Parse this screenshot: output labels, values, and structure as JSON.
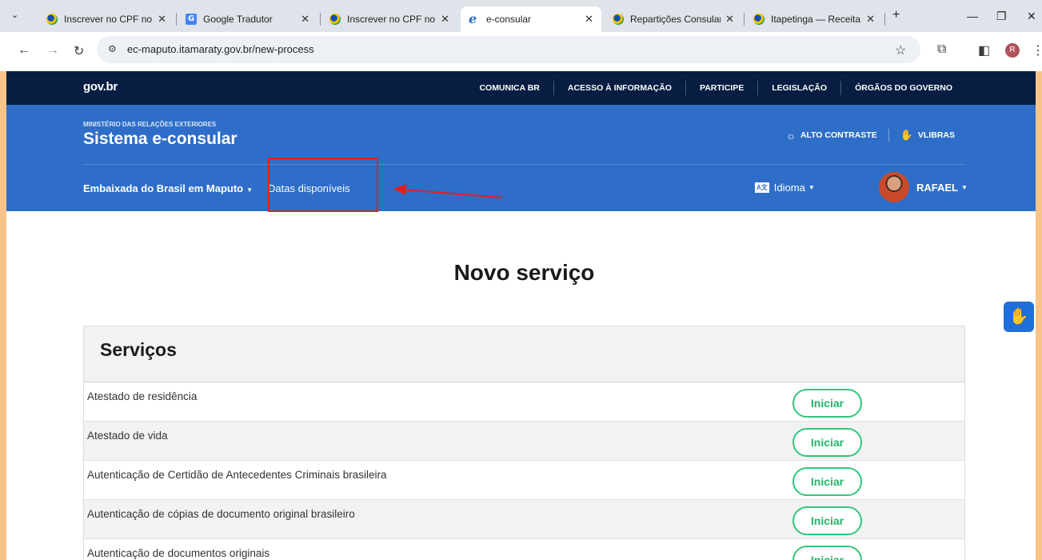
{
  "browser": {
    "tabs": [
      {
        "title": "Inscrever no CPF no e",
        "favicon": "gov-icon"
      },
      {
        "title": "Google Tradutor",
        "favicon": "translate-icon"
      },
      {
        "title": "Inscrever no CPF no e",
        "favicon": "gov-icon"
      },
      {
        "title": "e-consular",
        "favicon": "e-icon"
      },
      {
        "title": "Repartições Consular",
        "favicon": "gov-icon"
      },
      {
        "title": "Itapetinga — Receita",
        "favicon": "gov-icon"
      }
    ],
    "new_tab": "+",
    "url": "ec-maputo.itamaraty.gov.br/new-process",
    "profile_initial": "R"
  },
  "gov_bar": {
    "logo": "gov.br",
    "links": [
      "COMUNICA BR",
      "ACESSO À INFORMAÇÃO",
      "PARTICIPE",
      "LEGISLAÇÃO",
      "ÓRGÃOS DO GOVERNO"
    ]
  },
  "header": {
    "ministry": "MINISTÉRIO DAS RELAÇÕES EXTERIORES",
    "title": "Sistema e-consular",
    "high_contrast": "ALTO CONTRASTE",
    "vlibras": "VLIBRAS",
    "embassy": "Embaixada do Brasil em Maputo",
    "available_dates": "Datas disponíveis",
    "language": "Idioma",
    "user": "RAFAEL"
  },
  "main": {
    "title": "Novo serviço",
    "services_heading": "Serviços",
    "start_label": "Iniciar",
    "services": [
      "Atestado de residência",
      "Atestado de vida",
      "Autenticação de Certidão de Antecedentes Criminais brasileira",
      "Autenticação de cópias de documento original brasileiro",
      "Autenticação de documentos originais"
    ]
  },
  "colors": {
    "gov_bar": "#071d41",
    "header_blue": "#2e6ec8",
    "start_green": "#2fc879",
    "annotation_red": "#e02020",
    "backdrop": "#f6c48a"
  }
}
